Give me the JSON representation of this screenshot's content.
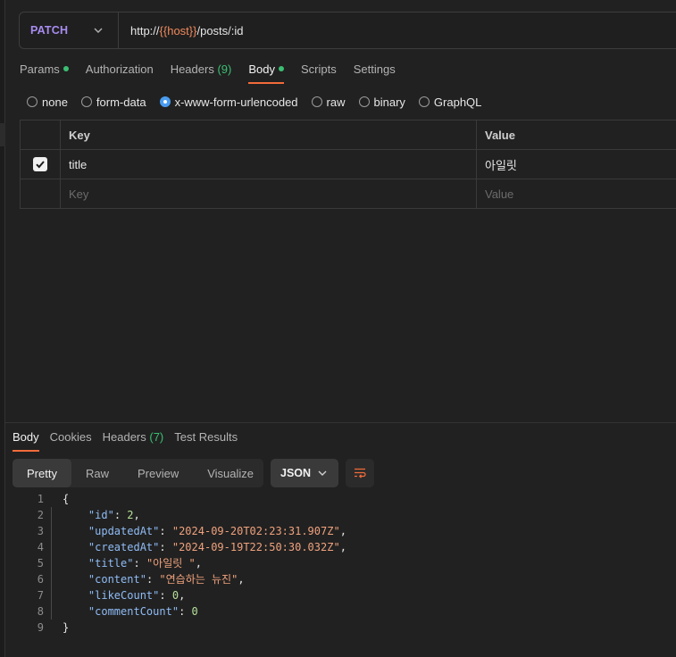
{
  "request": {
    "method": "PATCH",
    "url_prefix": "http://",
    "url_variable": "{{host}}",
    "url_suffix": "/posts/:id"
  },
  "request_tabs": [
    {
      "label": "Params",
      "dot": true
    },
    {
      "label": "Authorization"
    },
    {
      "label": "Headers",
      "count": "(9)"
    },
    {
      "label": "Body",
      "dot": true,
      "active": true
    },
    {
      "label": "Scripts"
    },
    {
      "label": "Settings"
    }
  ],
  "body_types": [
    {
      "label": "none"
    },
    {
      "label": "form-data"
    },
    {
      "label": "x-www-form-urlencoded",
      "selected": true
    },
    {
      "label": "raw"
    },
    {
      "label": "binary"
    },
    {
      "label": "GraphQL"
    }
  ],
  "table": {
    "headers": {
      "key": "Key",
      "value": "Value"
    },
    "rows": [
      {
        "checked": true,
        "key": "title",
        "value": "아일릿"
      }
    ],
    "placeholder": {
      "key": "Key",
      "value": "Value"
    }
  },
  "response_tabs": [
    {
      "label": "Body",
      "active": true
    },
    {
      "label": "Cookies"
    },
    {
      "label": "Headers",
      "count": "(7)"
    },
    {
      "label": "Test Results"
    }
  ],
  "view_modes": [
    "Pretty",
    "Raw",
    "Preview",
    "Visualize"
  ],
  "format": "JSON",
  "code": {
    "line_numbers": [
      "1",
      "2",
      "3",
      "4",
      "5",
      "6",
      "7",
      "8",
      "9"
    ],
    "open": "{",
    "close": "}",
    "fields": [
      {
        "key": "\"id\"",
        "value": "2",
        "kind": "num",
        "comma": ","
      },
      {
        "key": "\"updatedAt\"",
        "value": "\"2024-09-20T02:23:31.907Z\"",
        "kind": "str",
        "comma": ","
      },
      {
        "key": "\"createdAt\"",
        "value": "\"2024-09-19T22:50:30.032Z\"",
        "kind": "str",
        "comma": ","
      },
      {
        "key": "\"title\"",
        "value": "\"아일릿 \"",
        "kind": "str",
        "comma": ","
      },
      {
        "key": "\"content\"",
        "value": "\"연습하는 뉴진\"",
        "kind": "str",
        "comma": ","
      },
      {
        "key": "\"likeCount\"",
        "value": "0",
        "kind": "num",
        "comma": ","
      },
      {
        "key": "\"commentCount\"",
        "value": "0",
        "kind": "num",
        "comma": ""
      }
    ]
  },
  "colors": {
    "accent": "#f26b3a",
    "method": "#a88cf0",
    "success": "#3bbf73",
    "radio": "#4a9cf0"
  }
}
